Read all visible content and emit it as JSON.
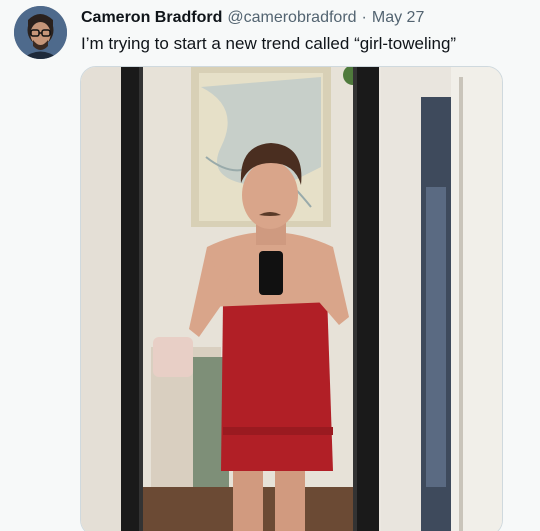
{
  "tweet": {
    "display_name": "Cameron Bradford",
    "handle": "@camerobradford",
    "separator": "·",
    "date": "May 27",
    "text": "I’m trying to start a new trend called “girl-toweling”",
    "avatar_icon": "user-avatar-icon",
    "photo": {
      "description_icon": "mirror-selfie-photo",
      "colors": {
        "wall": "#ece8e1",
        "mirror_frame": "#1a1a1a",
        "towel": "#b11f26",
        "skin": "#d9a58a",
        "hair": "#4a2e20",
        "map": "#d8d0b6",
        "floor": "#6b4a34"
      }
    }
  }
}
